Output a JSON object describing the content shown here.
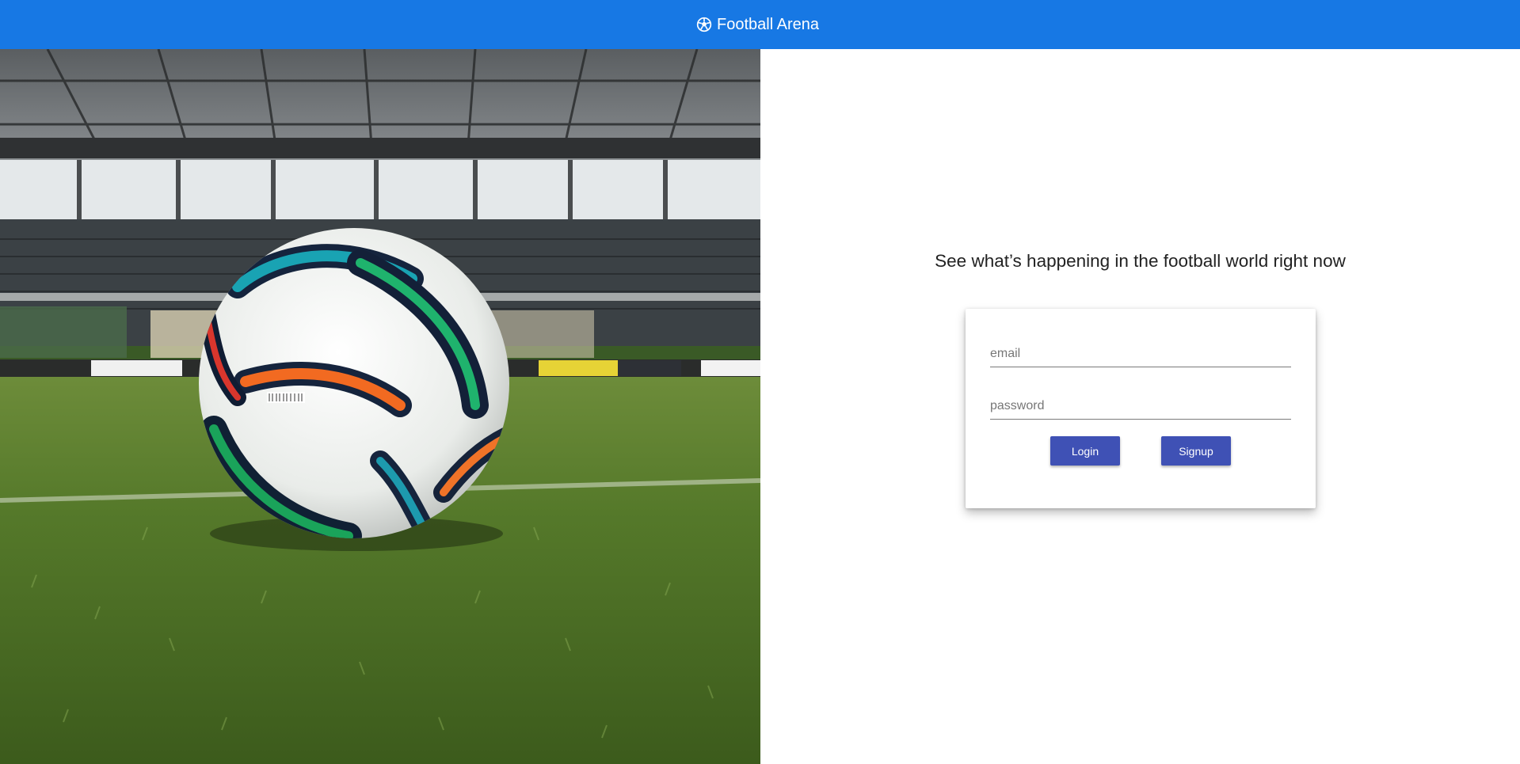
{
  "header": {
    "brand_icon": "soccer-ball-icon",
    "title": "Football Arena",
    "background": "#1778e4"
  },
  "hero": {
    "image": "soccer-ball-on-stadium-grass"
  },
  "main": {
    "tagline": "See what’s happening in the football world right now",
    "form": {
      "email_placeholder": "email",
      "email_value": "",
      "password_placeholder": "password",
      "password_value": "",
      "login_label": "Login",
      "signup_label": "Signup",
      "button_color": "#3f51b5"
    }
  }
}
